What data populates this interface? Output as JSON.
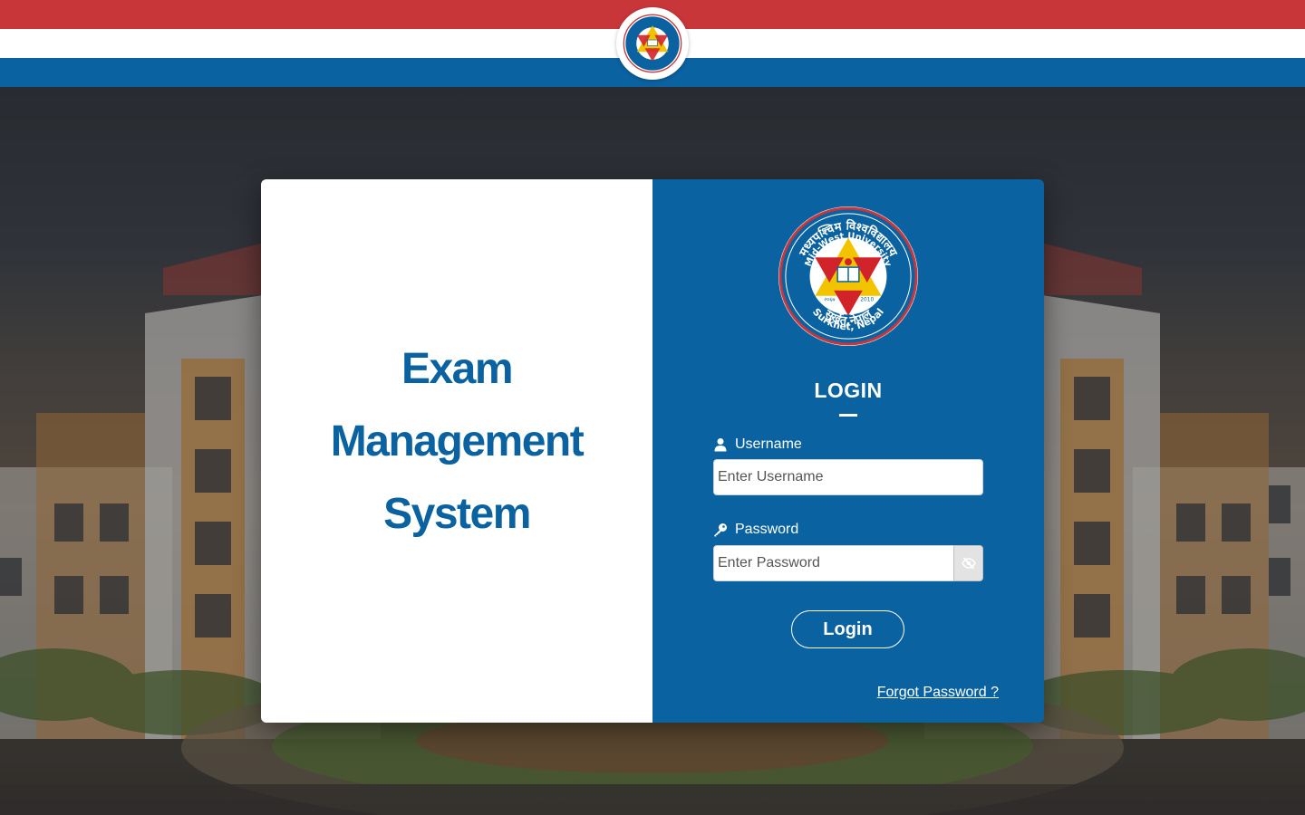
{
  "header": {
    "logo_icon": "university-seal-icon",
    "stripe_colors": {
      "red": "#c8363a",
      "white": "#ffffff",
      "blue": "#0b62a0"
    }
  },
  "branding": {
    "title_lines": [
      "Exam",
      "Management",
      "System"
    ],
    "accent_color": "#0b62a0",
    "seal_text_nepali": "मध्यपश्चिम विश्वविद्यालय",
    "seal_text_english": "Mid-West University",
    "seal_location_nepali": "सुर्खेत,नेपाल",
    "seal_location_english": "Surkhet, Nepal",
    "seal_year_nepali": "२०६७",
    "seal_year": "2010"
  },
  "login": {
    "heading": "LOGIN",
    "username_label": "Username",
    "username_placeholder": "Enter Username",
    "username_icon": "user-icon",
    "password_label": "Password",
    "password_placeholder": "Enter Password",
    "password_icon": "key-icon",
    "toggle_icon": "eye-slash-icon",
    "submit_label": "Login",
    "forgot_label": "Forgot Password ?"
  }
}
